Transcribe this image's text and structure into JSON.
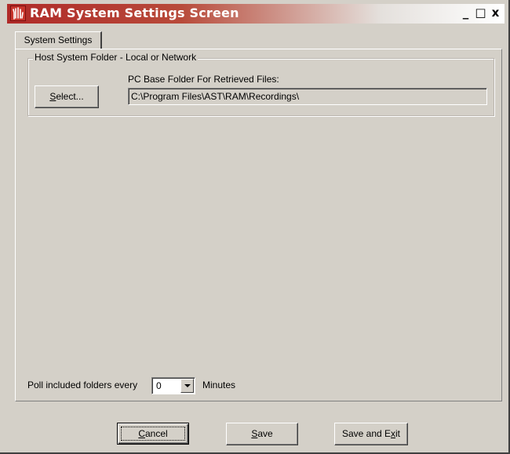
{
  "window": {
    "title": "RAM System Settings Screen",
    "icon": "hand-logo-icon",
    "controls": {
      "minimize": "_",
      "maximize": "□",
      "close": "x"
    }
  },
  "tabs": [
    {
      "label": "System Settings",
      "selected": true
    }
  ],
  "host_folder_group": {
    "legend": "Host System Folder - Local or Network",
    "select_button": {
      "prefix": "S",
      "rest": "elect..."
    },
    "field_label": "PC Base Folder For Retrieved Files:",
    "field_value": "C:\\Program Files\\AST\\RAM\\Recordings\\"
  },
  "poll": {
    "label": "Poll included folders every",
    "value": "0",
    "unit": "Minutes"
  },
  "buttons": {
    "cancel": {
      "prefix": "C",
      "rest": "ancel"
    },
    "save": {
      "prefix": "S",
      "rest": "ave"
    },
    "save_exit": {
      "before": "Save and E",
      "key": "x",
      "after": "it"
    }
  },
  "colors": {
    "title_bar_start": "#b02a28",
    "title_bar_end": "#ffffff",
    "window_face": "#d4d0c8"
  }
}
